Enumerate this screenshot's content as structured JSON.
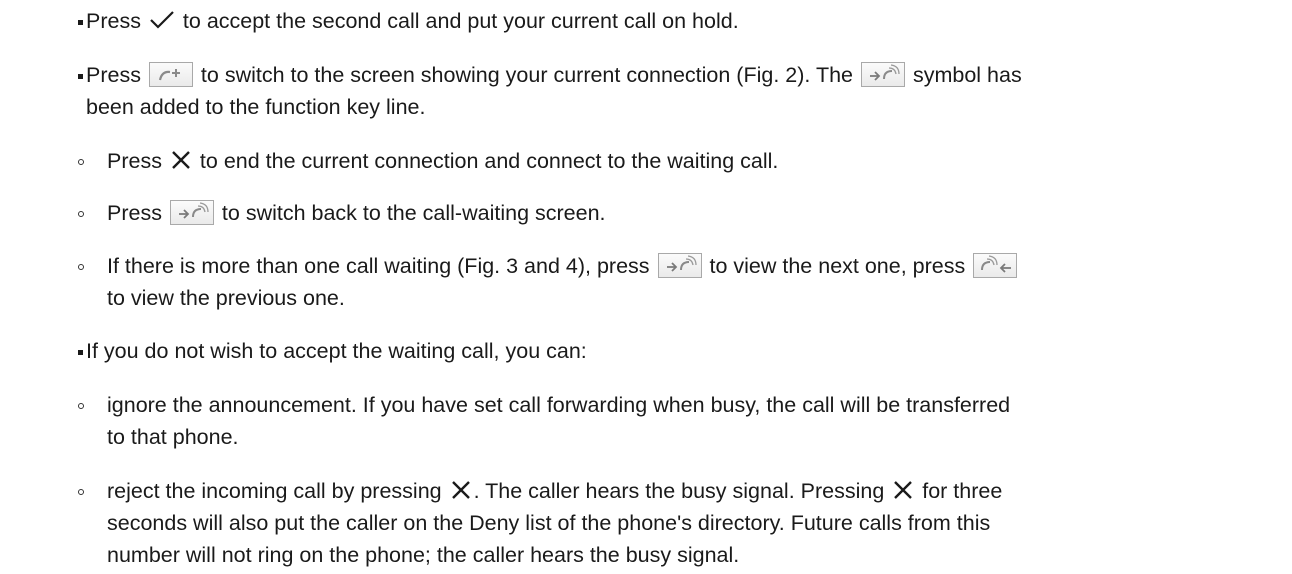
{
  "items": {
    "accept": {
      "pre": "Press ",
      "post": " to accept the second call and put your current call on hold.",
      "icon": "checkmark-icon"
    },
    "switch_screen": {
      "pre": "Press ",
      "mid": " to switch to the screen showing your current connection (Fig. 2).  The ",
      "post": " symbol has",
      "line2": "been added to the function key line.",
      "icon_a": "handset-back-arrow-icon",
      "icon_b": "forward-waiting-call-icon"
    },
    "end_current": {
      "pre": "Press ",
      "post": " to end the current connection and connect to the waiting call.",
      "icon": "x-icon"
    },
    "switch_back": {
      "pre": "Press ",
      "post": " to switch back to the call-waiting screen.",
      "icon": "forward-waiting-call-icon"
    },
    "more_waiting": {
      "pre": "If there is more than one call waiting (Fig. 3 and 4), press ",
      "mid": " to view the next one, press ",
      "line2": "to view the previous one.",
      "icon_next": "forward-waiting-call-icon",
      "icon_prev": "back-waiting-call-icon"
    },
    "decline_intro": {
      "text": "If you do not wish to accept the waiting call, you can:"
    },
    "ignore": {
      "line1": "ignore the announcement.  If you have set call forwarding when busy, the call will be transferred",
      "line2": "to that phone."
    },
    "reject": {
      "pre": "reject the incoming call by pressing ",
      "mid": ".  The caller hears the busy signal.  Pressing ",
      "post": " for three",
      "line2": "seconds will also put the caller on the Deny list of the phone's directory.  Future calls from this",
      "line3": "number will not ring on the phone;  the caller hears the busy signal.",
      "icon": "x-icon"
    }
  },
  "colors": {
    "text": "#1a1a1a",
    "icon_stroke": "#8a8a8a",
    "key_border": "#a9a9a9"
  }
}
